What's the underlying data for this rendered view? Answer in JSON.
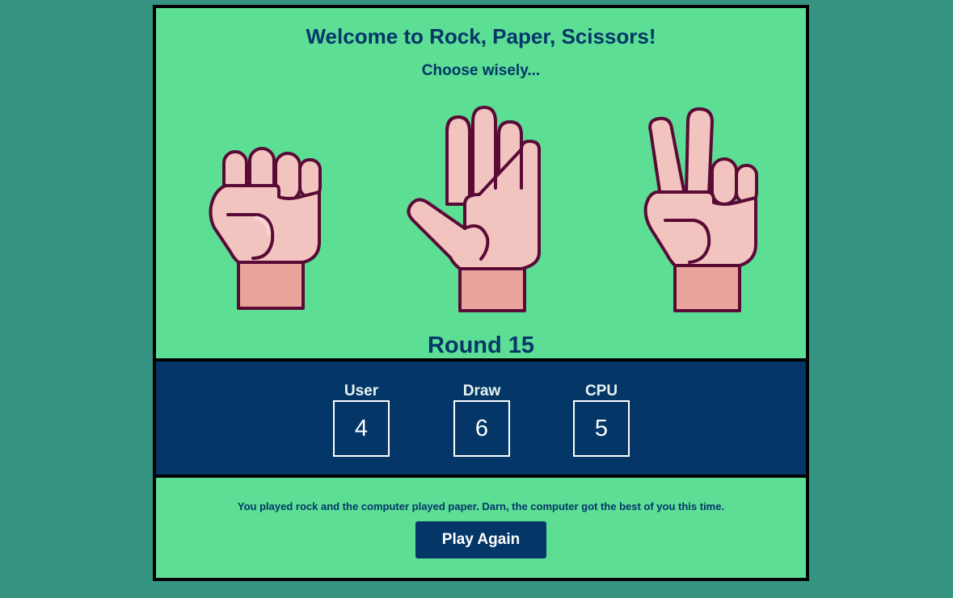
{
  "header": {
    "title": "Welcome to Rock, Paper, Scissors!",
    "subtitle": "Choose wisely..."
  },
  "choices": [
    {
      "name": "rock",
      "icon": "fist-hand-icon"
    },
    {
      "name": "paper",
      "icon": "open-hand-icon"
    },
    {
      "name": "scissors",
      "icon": "peace-hand-icon"
    }
  ],
  "round": {
    "label": "Round 15"
  },
  "scores": {
    "user": {
      "label": "User",
      "value": "4"
    },
    "draw": {
      "label": "Draw",
      "value": "6"
    },
    "cpu": {
      "label": "CPU",
      "value": "5"
    }
  },
  "result": {
    "message": "You played rock and the computer played paper. Darn, the computer got the best of you this time.",
    "button_label": "Play Again"
  },
  "colors": {
    "page_background": "#369483",
    "panel_green": "#5cde95",
    "navy": "#043668",
    "skin": "#f2c4bf",
    "skin_shadow": "#e8a49a",
    "outline": "#5a0a36"
  }
}
